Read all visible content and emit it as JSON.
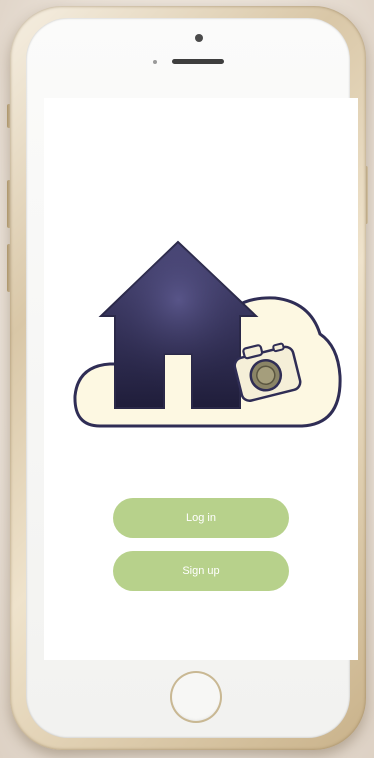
{
  "device": {
    "frame_color": "#d9c7a7",
    "home_button_icon": "home-button-ring"
  },
  "app": {
    "logo": {
      "icon": "house-cloud-camera-logo",
      "colors": {
        "house": "#2d2b4f",
        "cloud_fill": "#fdf8e2",
        "cloud_outline": "#2f2d55",
        "camera": "#f5efd8"
      }
    },
    "buttons": {
      "login_label": "Log in",
      "signup_label": "Sign up",
      "color": "#b7d18b",
      "text_color": "#ffffff"
    }
  }
}
